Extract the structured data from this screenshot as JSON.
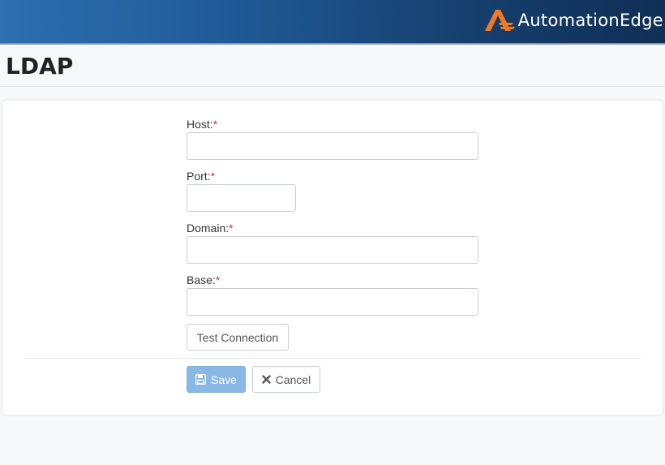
{
  "brand": {
    "name": "AutomationEdge",
    "accent": "#f07a24"
  },
  "page": {
    "title": "LDAP"
  },
  "form": {
    "fields": [
      {
        "label": "Host:",
        "required_mark": "*",
        "value": "",
        "placeholder": ""
      },
      {
        "label": "Port:",
        "required_mark": "*",
        "value": "",
        "placeholder": ""
      },
      {
        "label": "Domain:",
        "required_mark": "*",
        "value": "",
        "placeholder": ""
      },
      {
        "label": "Base:",
        "required_mark": "*",
        "value": "",
        "placeholder": ""
      }
    ],
    "test_label": "Test Connection",
    "save_label": "Save",
    "cancel_label": "Cancel",
    "icons": {
      "save": "floppy-disk-icon",
      "cancel": "close-icon"
    },
    "colors": {
      "save_bg": "#8ab8e4",
      "required": "#d9302c"
    }
  }
}
